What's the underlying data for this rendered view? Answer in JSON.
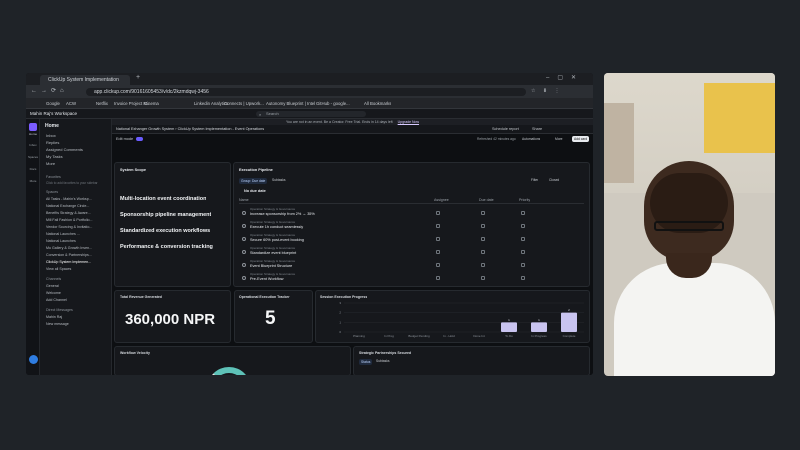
{
  "browser": {
    "tab_title": "ClickUp System Implementation",
    "url": "app.clickup.com/90161605453/v/dc/2kzmdqwj-3456",
    "bookmarks": [
      "Google",
      "ACW",
      "Netflix",
      "Invoice Project M...",
      "Cinema",
      "Linkedin Analytics",
      "Connects | Upwork...",
      "Autonomy Blueprint | Intel",
      "GitHub - google...",
      "All Bookmarks"
    ]
  },
  "app": {
    "top_search": "Search",
    "notice": "You are not in an event. Be a Creator. Free Trial. Ends in 14 days left",
    "upgrade_label": "Upgrade Now",
    "workspace": "Mahin Raj's Workspace",
    "rail_items": [
      "Home",
      "Inbox",
      "Spaces",
      "Docs",
      "More"
    ],
    "sidebar": {
      "header": "Home",
      "items": [
        "Inbox",
        "Replies",
        "Assigned Comments",
        "My Tasks",
        "More"
      ],
      "favorites_label": "Favorites",
      "favorites_hint": "Click to add favorites to your sidebar",
      "spaces_label": "Spaces",
      "spaces": [
        "All Tasks - Mahin's Worksp...",
        "National Exchange Circle...",
        "Benefits Strategy & Aware...",
        "Mill Fall Fashion & Portfolio...",
        "Vendor Sourcing & Invitatio...",
        "National Launches ...",
        "National Launches",
        "Mu Gallery & Growth Inven...",
        "Conversion & Partnerships...",
        "ClickUp System Implemen...",
        "View all Spaces"
      ],
      "channels_label": "Channels",
      "channels": [
        "General",
        "Welcome",
        "Add Channel"
      ],
      "dm_label": "Direct Messages",
      "dms": [
        "Mahin Raj",
        "New message"
      ]
    },
    "breadcrumb": "National Exhanger Growth System  ›  ClickUp System Implementation - Event Operations",
    "share_label": "Share",
    "schedule_label": "Schedule report",
    "automate_label": "Automations",
    "add_card_label": "Add card",
    "edit_mode_label": "Edit mode",
    "refresh_label": "Refreshed 42 minutes ago",
    "more_label": "More"
  },
  "system_scope": {
    "title": "System Scope",
    "items": [
      "Multi-location event coordination",
      "Sponsorship pipeline management",
      "Standardized execution workflows",
      "Performance & conversion tracking"
    ]
  },
  "pipeline": {
    "title": "Execution Pipeline",
    "filters": [
      "Group: Due date",
      "Subtasks"
    ],
    "actions": [
      "Filter",
      "Closed"
    ],
    "group_label": "No due date",
    "columns": [
      "Name",
      "Assignee",
      "Due date",
      "Priority"
    ],
    "rows": [
      {
        "path": "Operation Strategy & Governance",
        "name": "Increase sponsorship from 2% → 35%"
      },
      {
        "path": "Operation Strategy & Governance",
        "name": "Execute 1h conduct seamlessly"
      },
      {
        "path": "Operation Strategy & Governance",
        "name": "Secure 60% post-event booking"
      },
      {
        "path": "Operation Strategy & Governance",
        "name": "Standardize event blueprint"
      },
      {
        "path": "Operation Strategy & Governance",
        "name": "Event Blueprint Structure"
      },
      {
        "path": "Operation Strategy & Governance",
        "name": "Pre-Event Workflow"
      }
    ]
  },
  "kpis": [
    {
      "title": "Total Revenue Generated",
      "value": "360,000 NPR"
    },
    {
      "title": "Operational Execution Tracker",
      "value": "5"
    }
  ],
  "progress_chart": {
    "title": "Session Execution Progress",
    "y_ticks": [
      "3",
      "2",
      "1",
      "0"
    ],
    "chart_data": {
      "type": "bar",
      "categories": [
        "Planning",
        "In Prog",
        "Budget Pending",
        "In - Hold",
        "Done Int",
        "To Do",
        "In Progress",
        "Complete"
      ],
      "values": [
        0,
        0,
        0,
        0,
        0,
        1,
        1,
        2
      ],
      "ylim": [
        0,
        3
      ]
    }
  },
  "bottom_cards": [
    "Workflow Velocity",
    "Strategic Partnerships Secured"
  ],
  "bottom_filters": [
    "Status",
    "Subtasks"
  ]
}
